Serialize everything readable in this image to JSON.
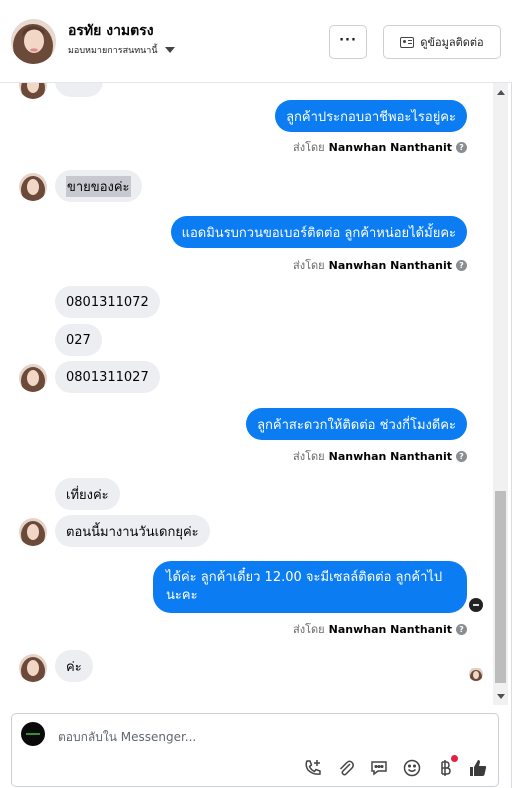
{
  "header": {
    "name": "อรทัย งามตรง",
    "assign_label": "มอบหมายการสนทนานี้",
    "more_label": "···",
    "contact_button": "ดูข้อมูลติดต่อ"
  },
  "messages": {
    "m1": "ลูกค้าประกอบอาชีพอะไรอยู่คะ",
    "m2": "ขายของค่ะ",
    "m3": "แอดมินรบกวนขอเบอร์ติดต่อ ลูกค้าหน่อยได้มั้ยคะ",
    "m4": "0801311072",
    "m5": "027",
    "m6": "0801311027",
    "m7": "ลูกค้าสะดวกให้ติดต่อ ช่วงกี่โมงดีคะ",
    "m8": "เที่ยงค่ะ",
    "m9": "ตอนนี้มางานวันเดกยุค่ะ",
    "m10": "ได้ค่ะ ลูกค้าเดี๋ยว 12.00 จะมีเซลล์ติดต่อ ลูกค้าไปนะคะ",
    "m11": "ค่ะ"
  },
  "sent_by": {
    "prefix": "ส่งโดย",
    "agent": "Nanwhan Nanthanit"
  },
  "composer": {
    "placeholder": "ตอบกลับใน Messenger..."
  },
  "icons": [
    "chevron-down-icon",
    "id-card-icon",
    "help-icon",
    "phone-add-icon",
    "paperclip-icon",
    "chat-bubble-icon",
    "emoji-icon",
    "baht-icon",
    "thumbs-up-icon"
  ],
  "colors": {
    "outgoing": "#0b7cf2",
    "incoming": "#eceef1",
    "notification": "#e41e3f"
  }
}
